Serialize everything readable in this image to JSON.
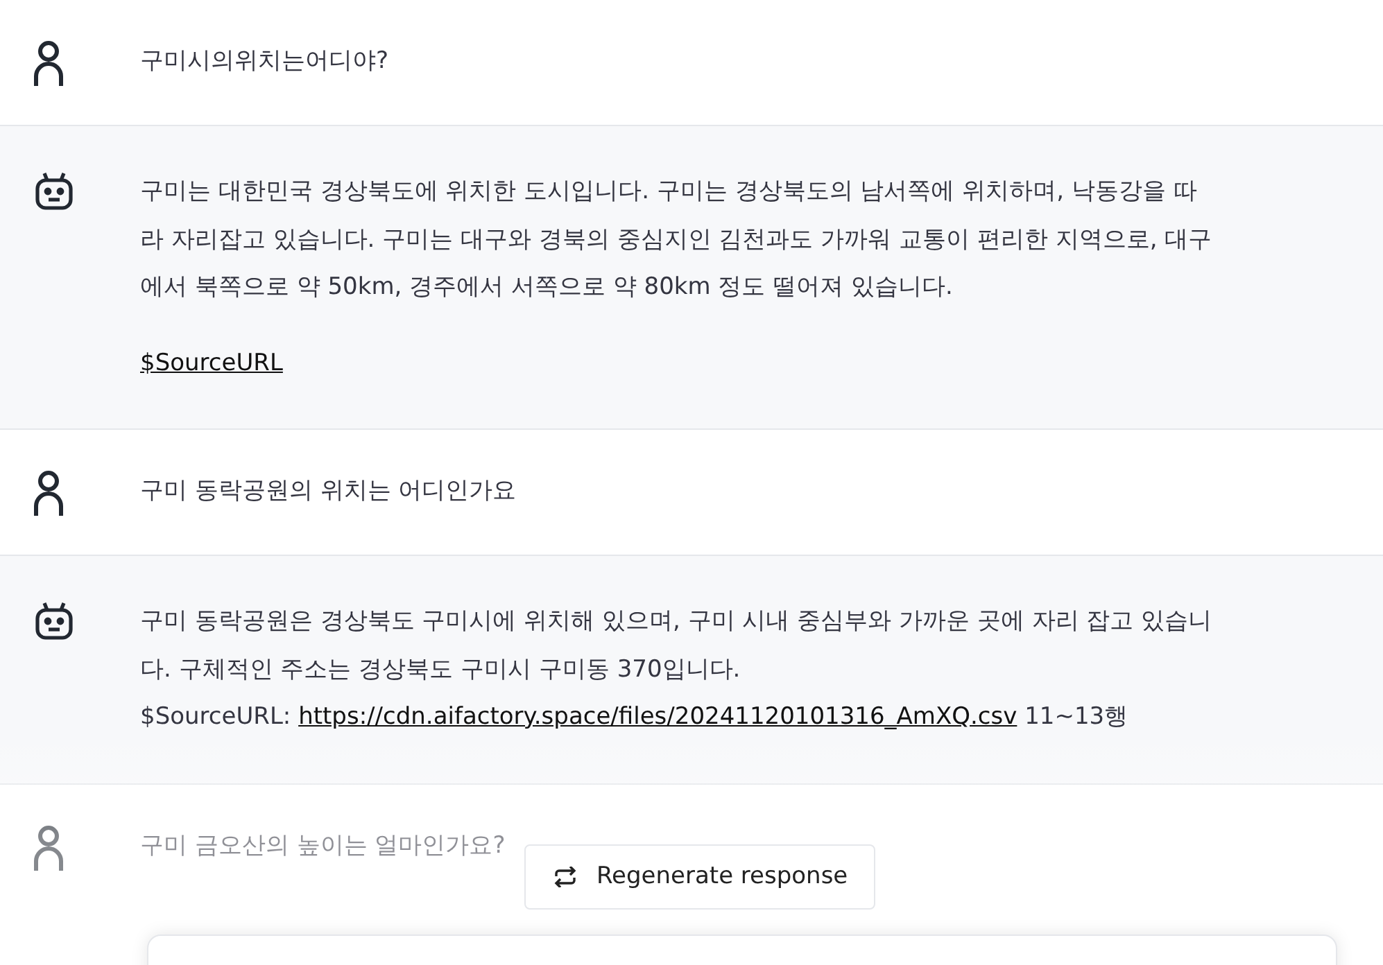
{
  "messages": [
    {
      "kind": "user",
      "paragraphs": [
        [
          {
            "text": "구미시의위치는어디야?"
          }
        ]
      ]
    },
    {
      "kind": "bot",
      "paragraphs": [
        [
          {
            "text": "구미는 대한민국 경상북도에 위치한 도시입니다. 구미는 경상북도의 남서쪽에 위치하며, 낙동강을 따라 자리잡고 있습니다. 구미는 대구와 경북의 중심지인 김천과도 가까워 교통이 편리한 지역으로, 대구에서 북쪽으로 약 50km, 경주에서 서쪽으로 약 80km 정도 떨어져 있습니다."
          }
        ],
        [
          {
            "link": "$SourceURL"
          }
        ]
      ]
    },
    {
      "kind": "user",
      "paragraphs": [
        [
          {
            "text": "구미 동락공원의 위치는 어디인가요"
          }
        ]
      ]
    },
    {
      "kind": "bot",
      "paragraphs": [
        [
          {
            "text": "구미 동락공원은 경상북도 구미시에 위치해 있으며, 구미 시내 중심부와 가까운 곳에 자리 잡고 있습니다. 구체적인 주소는 경상북도 구미시 구미동 370입니다."
          }
        ],
        [
          {
            "text": "$SourceURL: "
          },
          {
            "link": "https://cdn.aifactory.space/files/20241120101316_AmXQ.csv"
          },
          {
            "text": " 11~13행"
          }
        ]
      ]
    },
    {
      "kind": "user",
      "paragraphs": [
        [
          {
            "text": "구미 금오산의 높이는 얼마인가요?"
          }
        ]
      ]
    }
  ],
  "regenerate_button": {
    "label": "Regenerate response"
  }
}
